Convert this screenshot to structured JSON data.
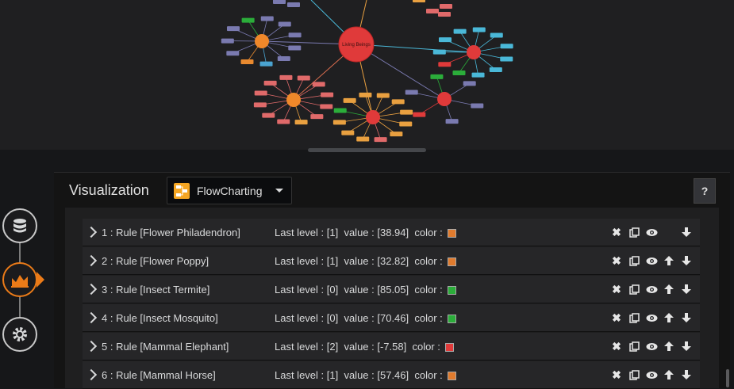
{
  "graph": {
    "center_label": "Living Beings",
    "hubs": [
      "Tree",
      "Flower",
      "Fungi",
      "Insect",
      "Mammal"
    ]
  },
  "panel": {
    "title": "Visualization",
    "plugin_name": "FlowCharting",
    "help_label": "?"
  },
  "colors": {
    "orange": "#e07b2e",
    "green": "#2bad3a",
    "red": "#e03a3a",
    "accent": "#eb7b18"
  },
  "rules": [
    {
      "label": "1 : Rule [Flower Philadendron]",
      "level": "Last level : [1]",
      "value": "value : [38.94]",
      "color_label": "color :",
      "color": "#e07b2e",
      "up": false
    },
    {
      "label": "2 : Rule [Flower Poppy]",
      "level": "Last level : [1]",
      "value": "value : [32.82]",
      "color_label": "color :",
      "color": "#e07b2e",
      "up": true
    },
    {
      "label": "3 : Rule [Insect Termite]",
      "level": "Last level : [0]",
      "value": "value : [85.05]",
      "color_label": "color :",
      "color": "#2bad3a",
      "up": true
    },
    {
      "label": "4 : Rule [Insect Mosquito]",
      "level": "Last level : [0]",
      "value": "value : [70.46]",
      "color_label": "color :",
      "color": "#2bad3a",
      "up": true
    },
    {
      "label": "5 : Rule [Mammal Elephant]",
      "level": "Last level : [2]",
      "value": "value : [-7.58]",
      "color_label": "color :",
      "color": "#e03a3a",
      "up": true
    },
    {
      "label": "6 : Rule [Mammal Horse]",
      "level": "Last level : [1]",
      "value": "value : [57.46]",
      "color_label": "color :",
      "color": "#e07b2e",
      "up": true
    }
  ]
}
